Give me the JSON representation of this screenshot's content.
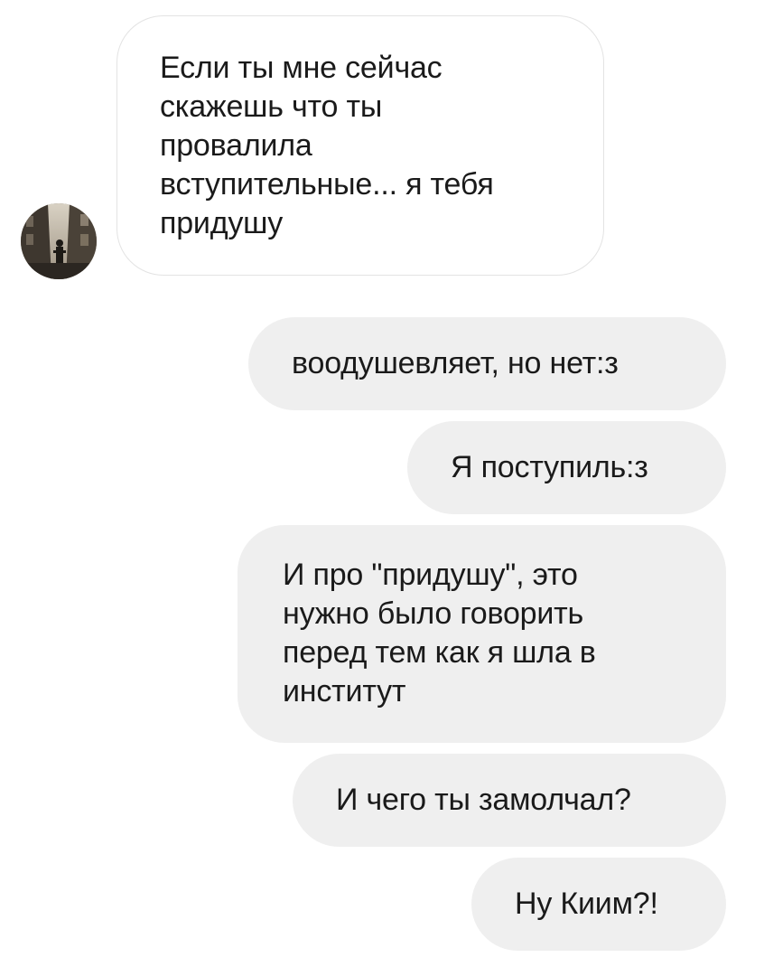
{
  "conversation": {
    "incoming": [
      {
        "text": "Если ты мне сейчас\nскажешь что ты\nпровалила\nвступительные... я тебя\nпридушу"
      }
    ],
    "outgoing": [
      {
        "text": "воодушевляет, но нет:з"
      },
      {
        "text": "Я поступиль:з"
      },
      {
        "text": "И про \"придушу\", это\nнужно было говорить\nперед тем как я шла в\nинститут"
      },
      {
        "text": "И чего ты замолчал?"
      },
      {
        "text": "Ну Киим?!"
      }
    ]
  },
  "avatar": {
    "icon": "street-photo-avatar-icon"
  },
  "colors": {
    "background": "#ffffff",
    "incoming_bubble": "#ffffff",
    "incoming_border": "#e3e3e3",
    "outgoing_bubble": "#efefef",
    "text": "#1a1a1a"
  }
}
